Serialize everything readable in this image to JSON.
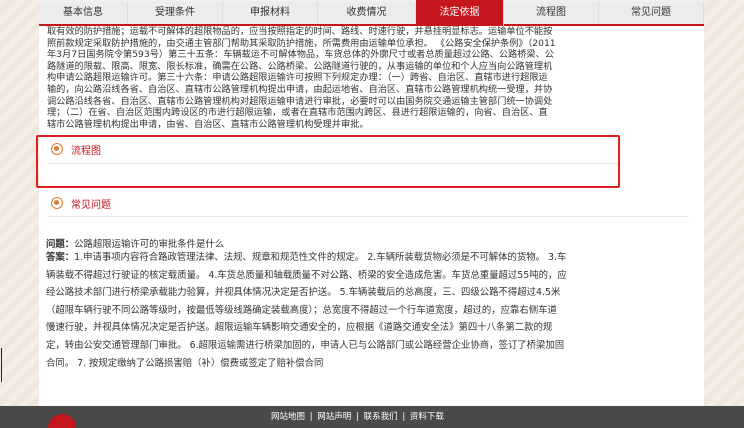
{
  "tabs": [
    "基本信息",
    "受理条件",
    "申报材料",
    "收费情况",
    "法定依据",
    "流程图",
    "常见问题"
  ],
  "active_tab": "法定依据",
  "legal_basis": {
    "lines": [
      "取有效的防护措施；运载不可解体的超限物品的，应当按照指定的时间、路线、时速行驶，并悬挂明显标志。运输单位不能按",
      "照前款规定采取防护措施的，由交通主管部门帮助其采取防护措施，所需费用由运输单位承担。 《公路安全保护条例》（2011",
      "年3月7日国务院令第593号）第三十五条：车辆载运不可解体物品，车货总体的外廓尺寸或者总质量超过公路、公路桥梁、公",
      "路隧道的限载、限高、限宽、限长标准，确需在公路、公路桥梁、公路隧道行驶的，从事运输的单位和个人应当向公路管理机",
      "构申请公路超限运输许可。第三十六条：申请公路超限运输许可按照下列规定办理：（一）跨省、自治区、直辖市进行超限运",
      "输的，向公路沿线各省、自治区、直辖市公路管理机构提出申请，由起运地省、自治区、直辖市公路管理机构统一受理，并协",
      "调公路沿线各省、自治区、直辖市公路管理机构对超限运输申请进行审批，必要时可以由国务院交通运输主管部门统一协调处",
      "理；（二）在省、自治区范围内跨设区的市进行超限运输，或者在直辖市范围内跨区、县进行超限运输的，向省、自治区、直",
      "辖市公路管理机构提出申请，由省、自治区、直辖市公路管理机构受理并审批。"
    ]
  },
  "flowchart": {
    "title": "流程图"
  },
  "faq": {
    "title": "常见问题",
    "question_label": "问题：",
    "question": "公路超限运输许可的审批条件是什么",
    "answer_label": "答案：",
    "answer_lines": [
      "1.申请事项内容符合路政管理法律、法规、规章和规范性文件的规定。 2.车辆所装载货物必须是不可解体的货物。 3.车",
      "辆装载不得超过行驶证的核定载质量。 4.车货总质量和轴载质量不对公路、桥梁的安全造成危害。车货总重量超过55吨的，应",
      "经公路技术部门进行桥梁承载能力验算，并视具体情况决定是否护送。 5.车辆装载后的总高度，三、四级公路不得超过4.5米",
      "（超限车辆行驶不同公路等级时，按最低等级线路确定装载高度）；总宽度不得超过一个行车道宽度，超过的，应靠右侧车道",
      "慢速行驶，并视具体情况决定是否护送。超限运输车辆影响交通安全的，应根据《道路交通安全法》第四十八条第二款的规",
      "定，转由公安交通管理部门审批。 6.超限运输需进行桥梁加固的，申请人已与公路部门或公路经营企业协商，签订了桥梁加固",
      "合同。 7. 按规定缴纳了公路损害赔（补）偿费或签定了赔补偿合同"
    ]
  },
  "footer": {
    "links": [
      "网站地图",
      "网站声明",
      "联系我们",
      "资料下载"
    ],
    "separator": "|"
  }
}
